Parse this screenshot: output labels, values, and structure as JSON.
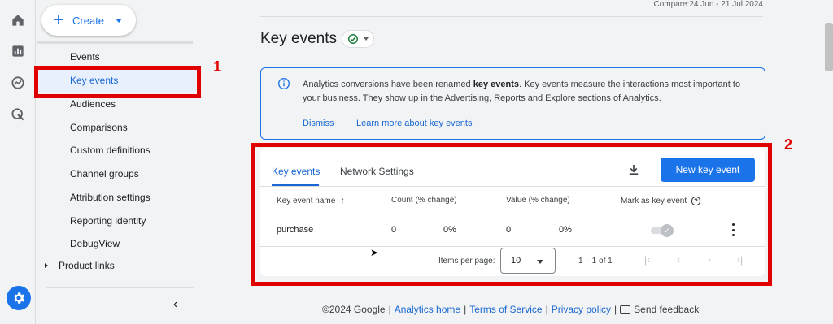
{
  "rail": {
    "icons": [
      "home-icon",
      "reports-icon",
      "explore-icon",
      "advertising-icon"
    ],
    "settings_icon": "gear-icon"
  },
  "sidebar": {
    "create_label": "Create",
    "items": [
      {
        "label": "Events"
      },
      {
        "label": "Key events"
      },
      {
        "label": "Audiences"
      },
      {
        "label": "Comparisons"
      },
      {
        "label": "Custom definitions"
      },
      {
        "label": "Channel groups"
      },
      {
        "label": "Attribution settings"
      },
      {
        "label": "Reporting identity"
      },
      {
        "label": "DebugView"
      }
    ],
    "product_links": "Product links",
    "collapse": "‹"
  },
  "annotations": {
    "one": "1",
    "two": "2"
  },
  "header": {
    "compare": "Compare:24 Jun - 21 Jul 2024",
    "title": "Key events"
  },
  "info": {
    "text_a": "Analytics conversions have been renamed ",
    "text_bold": "key events",
    "text_b": ". Key events measure the interactions most important to your business. They show up in the Advertising, Reports and Explore sections of Analytics.",
    "dismiss": "Dismiss",
    "learn_more": "Learn more about key events"
  },
  "card": {
    "tabs": [
      "Key events",
      "Network Settings"
    ],
    "new_button": "New key event",
    "columns": [
      "Key event name",
      "Count (% change)",
      "Value (% change)",
      "Mark as key event"
    ],
    "rows": [
      {
        "name": "purchase",
        "count": "0",
        "count_change": "0%",
        "value": "0",
        "value_change": "0%",
        "is_key_event": true
      }
    ],
    "items_per_page_label": "Items per page:",
    "items_per_page": "10",
    "range": "1 – 1 of 1"
  },
  "footer": {
    "copyright": "©2024 Google",
    "analytics_home": "Analytics home",
    "terms": "Terms of Service",
    "privacy": "Privacy policy",
    "feedback": "Send feedback"
  },
  "colors": {
    "accent": "#1a73e8",
    "annotation": "#e00000",
    "active_bg": "#e8f0fe"
  }
}
